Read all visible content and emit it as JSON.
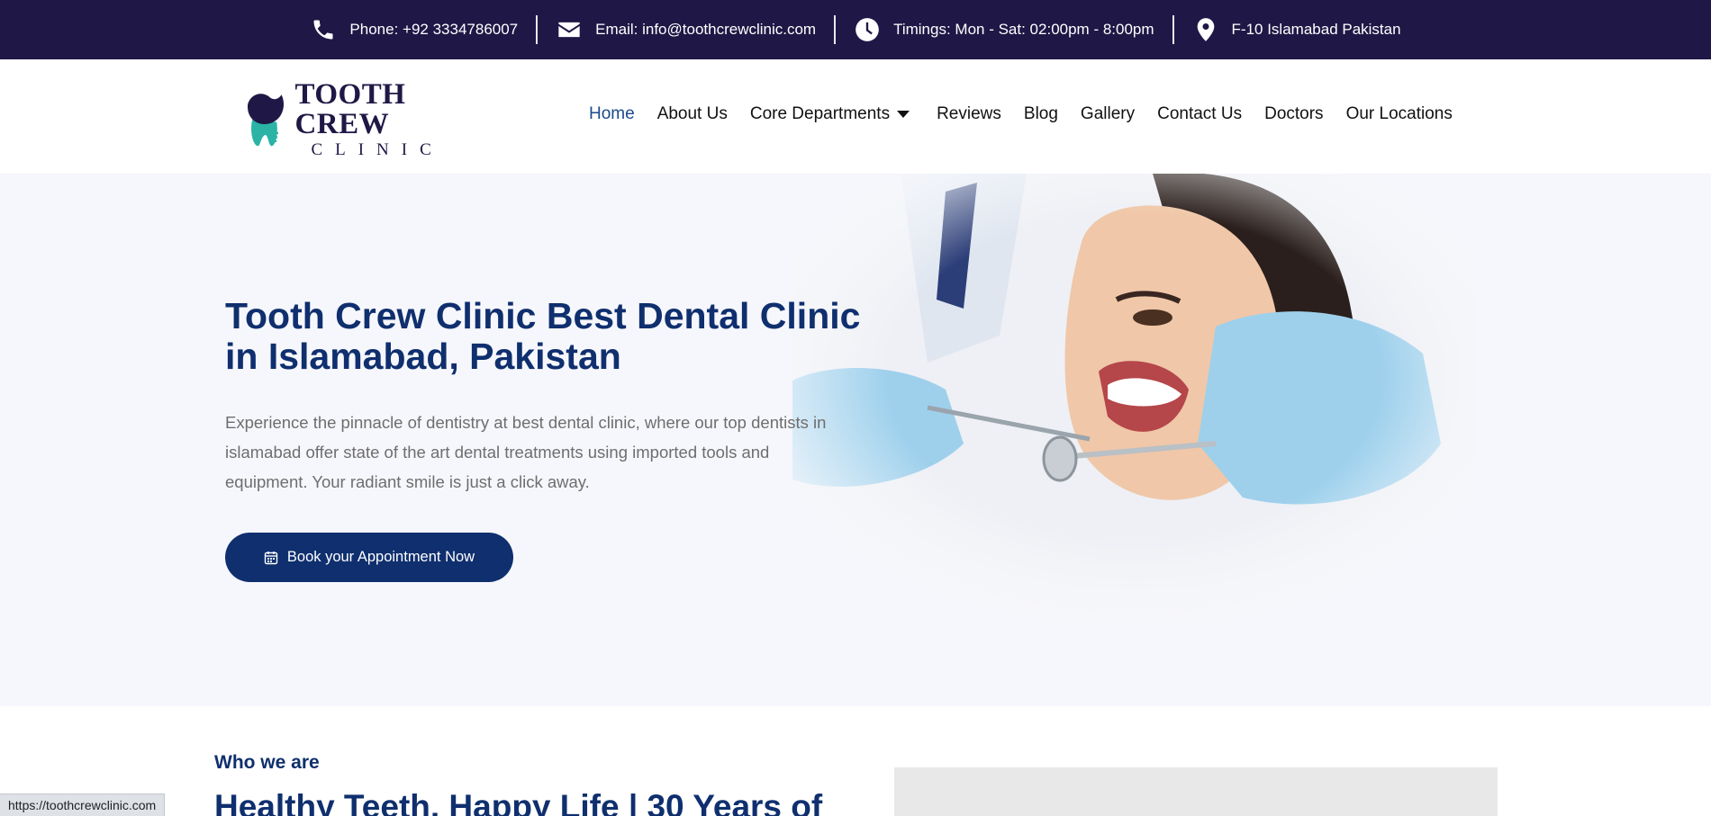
{
  "topbar": {
    "phone": "Phone: +92 3334786007",
    "email": "Email: info@toothcrewclinic.com",
    "timings": "Timings: Mon - Sat: 02:00pm - 8:00pm",
    "location": "F-10 Islamabad Pakistan"
  },
  "logo": {
    "line1": "TOOTH CREW",
    "line2": "CLINIC"
  },
  "nav": {
    "home": "Home",
    "about": "About Us",
    "core": "Core Departments",
    "reviews": "Reviews",
    "blog": "Blog",
    "gallery": "Gallery",
    "contact": "Contact Us",
    "doctors": "Doctors",
    "locations": "Our Locations"
  },
  "hero": {
    "title": "Tooth Crew Clinic Best Dental Clinic in Islamabad, Pakistan",
    "description": "Experience the pinnacle of dentistry at best dental clinic, where our top dentists in islamabad offer state of the art dental treatments using imported tools and equipment. Your radiant smile is just a click away.",
    "cta": "Book your Appointment Now"
  },
  "about": {
    "label": "Who we are",
    "title": "Healthy Teeth, Happy Life | 30 Years of"
  },
  "status": {
    "url": "https://toothcrewclinic.com"
  },
  "colors": {
    "topbar": "#1f1846",
    "primary": "#0f2f6e",
    "hero_bg": "#f6f7fc",
    "logo_teal": "#2bb3a6"
  }
}
